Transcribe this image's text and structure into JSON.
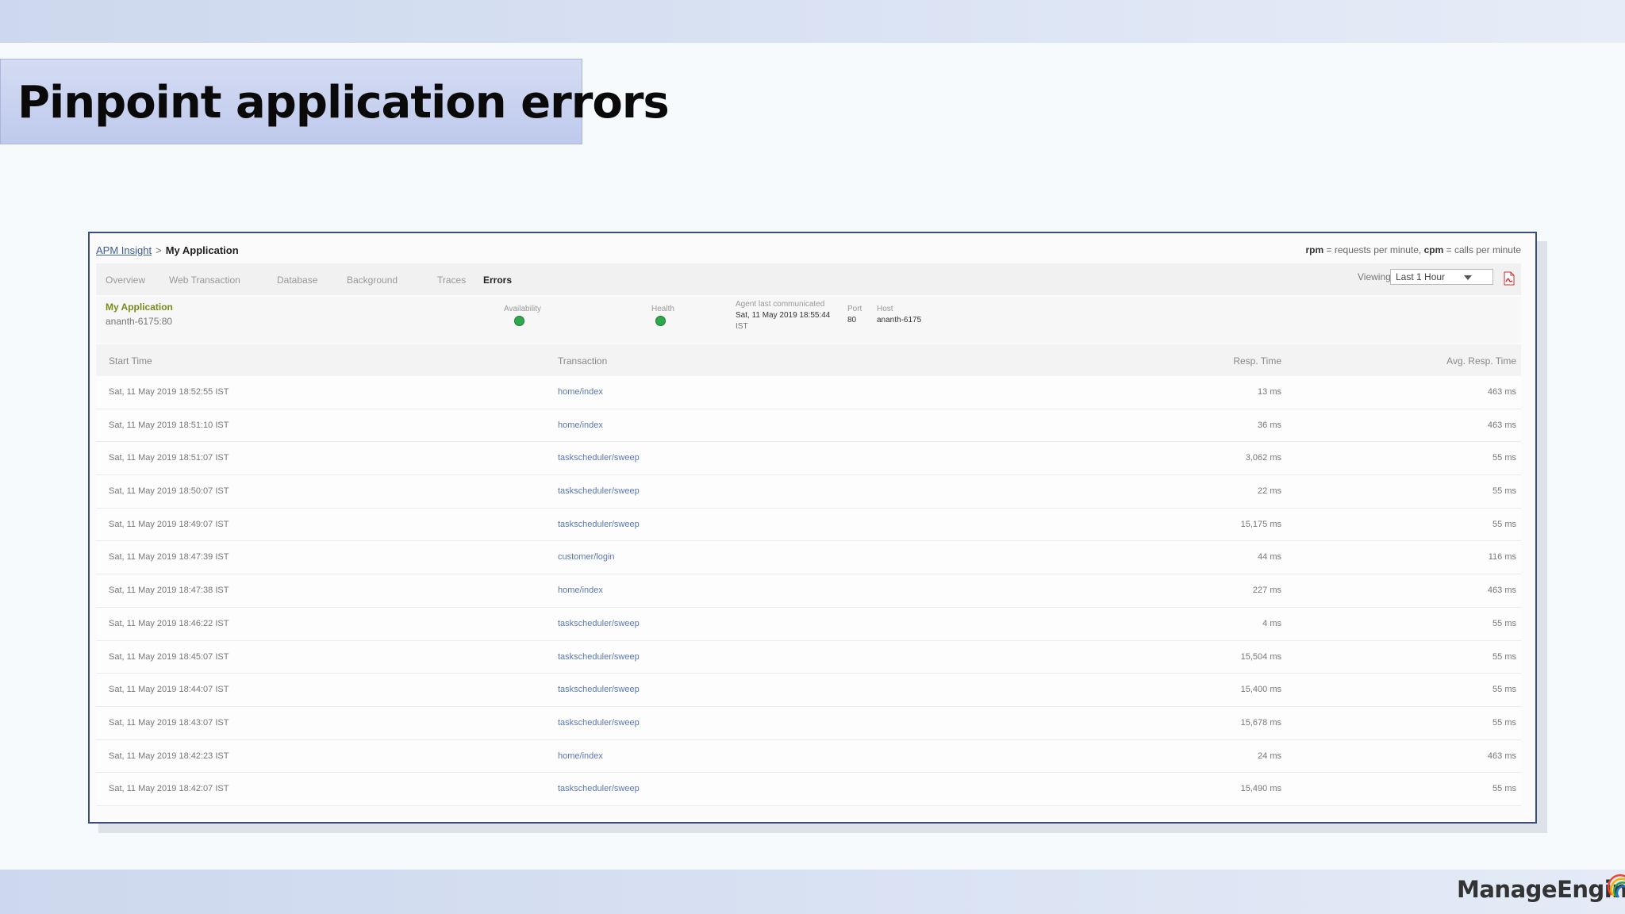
{
  "slide": {
    "title": "Pinpoint application errors",
    "brand": "ManageEngine"
  },
  "app": {
    "breadcrumb_root": "APM Insight",
    "breadcrumb_sep": ">",
    "breadcrumb_current": "My Application",
    "legend": {
      "rpm_key": "rpm",
      "rpm_text": " = requests per minute, ",
      "cpm_key": "cpm",
      "cpm_text": " = calls per minute"
    },
    "tabs": [
      "Overview",
      "Web Transaction",
      "Database",
      "Background",
      "Traces",
      "Errors"
    ],
    "active_tab": "Errors",
    "viewing_label": "Viewing",
    "viewing_value": "Last 1 Hour",
    "info": {
      "name": "My Application",
      "host_port": "ananth-6175:80",
      "availability_label": "Availability",
      "health_label": "Health",
      "agent_label": "Agent last communicated",
      "agent_value_line1": "Sat, 11 May 2019 18:55:44",
      "agent_value_line2": "IST",
      "port_label": "Port",
      "port_value": "80",
      "host_label": "Host",
      "host_value": "ananth-6175"
    },
    "columns": {
      "start_time": "Start Time",
      "transaction": "Transaction",
      "resp_time": "Resp. Time",
      "avg_resp_time": "Avg. Resp. Time"
    },
    "rows": [
      {
        "time": "Sat, 11 May 2019 18:52:55 IST",
        "txn": "home/index",
        "resp": "13 ms",
        "avg": "463 ms"
      },
      {
        "time": "Sat, 11 May 2019 18:51:10 IST",
        "txn": "home/index",
        "resp": "36 ms",
        "avg": "463 ms"
      },
      {
        "time": "Sat, 11 May 2019 18:51:07 IST",
        "txn": "taskscheduler/sweep",
        "resp": "3,062 ms",
        "avg": "55 ms"
      },
      {
        "time": "Sat, 11 May 2019 18:50:07 IST",
        "txn": "taskscheduler/sweep",
        "resp": "22 ms",
        "avg": "55 ms"
      },
      {
        "time": "Sat, 11 May 2019 18:49:07 IST",
        "txn": "taskscheduler/sweep",
        "resp": "15,175 ms",
        "avg": "55 ms"
      },
      {
        "time": "Sat, 11 May 2019 18:47:39 IST",
        "txn": "customer/login",
        "resp": "44 ms",
        "avg": "116 ms"
      },
      {
        "time": "Sat, 11 May 2019 18:47:38 IST",
        "txn": "home/index",
        "resp": "227 ms",
        "avg": "463 ms"
      },
      {
        "time": "Sat, 11 May 2019 18:46:22 IST",
        "txn": "taskscheduler/sweep",
        "resp": "4 ms",
        "avg": "55 ms"
      },
      {
        "time": "Sat, 11 May 2019 18:45:07 IST",
        "txn": "taskscheduler/sweep",
        "resp": "15,504 ms",
        "avg": "55 ms"
      },
      {
        "time": "Sat, 11 May 2019 18:44:07 IST",
        "txn": "taskscheduler/sweep",
        "resp": "15,400 ms",
        "avg": "55 ms"
      },
      {
        "time": "Sat, 11 May 2019 18:43:07 IST",
        "txn": "taskscheduler/sweep",
        "resp": "15,678 ms",
        "avg": "55 ms"
      },
      {
        "time": "Sat, 11 May 2019 18:42:23 IST",
        "txn": "home/index",
        "resp": "24 ms",
        "avg": "463 ms"
      },
      {
        "time": "Sat, 11 May 2019 18:42:07 IST",
        "txn": "taskscheduler/sweep",
        "resp": "15,490 ms",
        "avg": "55 ms"
      }
    ]
  },
  "colors": {
    "status_green": "#2ea84a",
    "link_blue": "#5a78b0",
    "app_name_olive": "#7a8a1a",
    "frame_border": "#3a4f7a"
  },
  "icons": {
    "pdf": "pdf-export-icon",
    "select_caret": "chevron-down-icon",
    "availability": "status-dot-icon",
    "health": "status-dot-icon",
    "brand_arc": "brand-arc-icon"
  }
}
